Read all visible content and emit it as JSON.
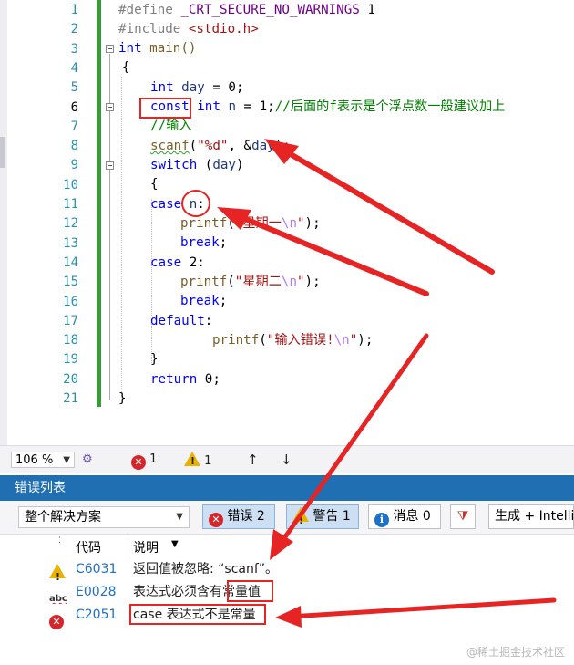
{
  "editor": {
    "line_numbers": [
      "1",
      "2",
      "3",
      "4",
      "5",
      "6",
      "7",
      "8",
      "9",
      "10",
      "11",
      "12",
      "13",
      "14",
      "15",
      "16",
      "17",
      "18",
      "19",
      "20",
      "21"
    ],
    "current_line": "6",
    "l1": {
      "directive": "#define",
      "macro": "_CRT_SECURE_NO_WARNINGS",
      "value": "1"
    },
    "l2": {
      "directive": "#include",
      "header": "<stdio.h>"
    },
    "l3": {
      "type": "int",
      "name": "main()"
    },
    "l4": {
      "brace": "{"
    },
    "l5": {
      "type": "int",
      "var": "day",
      "rest": " = 0;"
    },
    "l6": {
      "kw": "const",
      "type": "int",
      "var": "n",
      "rest": " = 1;",
      "comment": "//后面的f表示是个浮点数一般建议加上"
    },
    "l7": {
      "comment": "//输入"
    },
    "l8": {
      "fn": "scanf",
      "open": "(",
      "str": "\"%d\"",
      "rest": ", &",
      "var": "day",
      "close": ");"
    },
    "l9": {
      "kw": "switch",
      "open": " (",
      "var": "day",
      "close": ")"
    },
    "l10": {
      "brace": "{"
    },
    "l11": {
      "kw": "case",
      "var": "n",
      "colon": ":"
    },
    "l12": {
      "fn": "printf",
      "open": "(",
      "str": "\"星期一",
      "esc": "\\n",
      "str_end": "\"",
      "close": ");"
    },
    "l13": {
      "kw": "break",
      "semi": ";"
    },
    "l14": {
      "kw": "case",
      "rest": " 2:"
    },
    "l15": {
      "fn": "printf",
      "open": "(",
      "str": "\"星期二",
      "esc": "\\n",
      "str_end": "\"",
      "close": ");"
    },
    "l16": {
      "kw": "break",
      "semi": ";"
    },
    "l17": {
      "kw": "default",
      "colon": ":"
    },
    "l18": {
      "fn": "printf",
      "open": "(",
      "str": "\"输入错误!",
      "esc": "\\n",
      "str_end": "\"",
      "close": ");"
    },
    "l19": {
      "brace": "}"
    },
    "l20": {
      "kw": "return",
      "rest": " 0;"
    },
    "l21": {
      "brace": "}"
    }
  },
  "statusbar": {
    "zoom": "106 %",
    "error_count": "1",
    "warning_count": "1",
    "up_arrow": "↑",
    "down_arrow": "↓"
  },
  "error_list": {
    "title": "错误列表",
    "scope": "整个解决方案",
    "errors_btn": "错误 2",
    "warnings_btn": "警告 1",
    "messages_btn": "消息 0",
    "build_filter": "生成 + IntelliSense",
    "col_code": "代码",
    "col_desc": "说明",
    "rows": [
      {
        "code": "C6031",
        "desc": "返回值被忽略: “scanf”。"
      },
      {
        "code": "E0028",
        "desc_prefix": "表达式必须含有",
        "desc_highlight": "常量值"
      },
      {
        "code": "C2051",
        "desc": "case 表达式不是常量"
      }
    ]
  },
  "watermark": "@稀土掘金技术社区",
  "colors": {
    "panel_title_bg": "#1f6fb2",
    "annotation_red": "#e62424",
    "change_bar": "#3a9a37",
    "error_red": "#d6262b",
    "warning_yellow": "#e9b100"
  }
}
